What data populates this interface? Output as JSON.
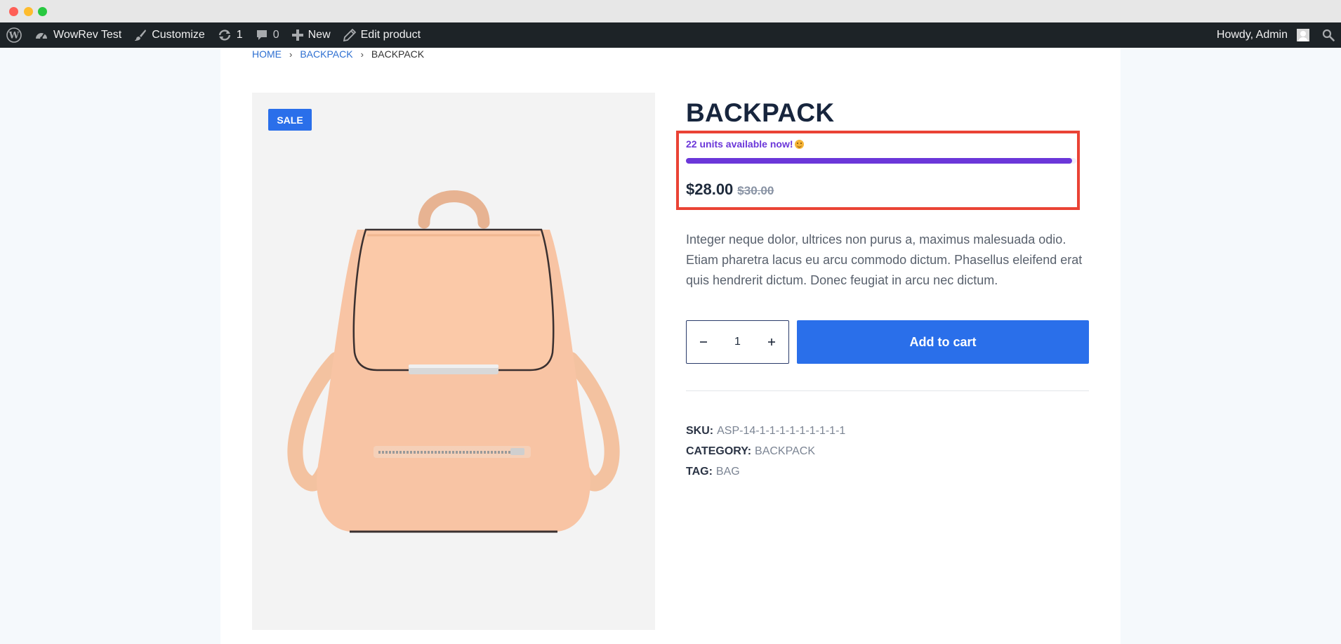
{
  "window": {
    "controls": [
      "close",
      "minimize",
      "maximize"
    ]
  },
  "admin_bar": {
    "site_name": "WowRev Test",
    "customize": "Customize",
    "updates_count": "1",
    "comments_count": "0",
    "new": "New",
    "edit_product": "Edit product",
    "greeting": "Howdy, Admin"
  },
  "breadcrumb": {
    "home": "HOME",
    "category": "BACKPACK",
    "current": "BACKPACK"
  },
  "product": {
    "badge": "SALE",
    "title": "BACKPACK",
    "stock_text": "22 units available now!",
    "stock_fraction": 0.99,
    "price_now": "$28.00",
    "price_old": "$30.00",
    "description": "Integer neque dolor, ultrices non purus a, maximus malesuada odio. Etiam pharetra lacus eu arcu commodo dictum. Phasellus eleifend erat quis hendrerit dictum. Donec feugiat in arcu nec dictum.",
    "quantity": "1",
    "add_to_cart": "Add to cart",
    "meta": {
      "sku_label": "SKU:",
      "sku": "ASP-14-1-1-1-1-1-1-1-1-1",
      "category_label": "CATEGORY:",
      "category": "BACKPACK",
      "tag_label": "TAG:",
      "tag": "BAG"
    }
  },
  "colors": {
    "accent": "#2a6fea",
    "stock": "#6b37d9",
    "highlight": "#ea4335",
    "admin_bar": "#1d2327"
  },
  "icons": [
    "wordpress-icon",
    "dashboard-icon",
    "brush-icon",
    "updates-icon",
    "comment-icon",
    "plus-icon",
    "pencil-icon",
    "avatar",
    "search-icon",
    "chevron-right-icon",
    "minus-icon",
    "plus-icon"
  ]
}
